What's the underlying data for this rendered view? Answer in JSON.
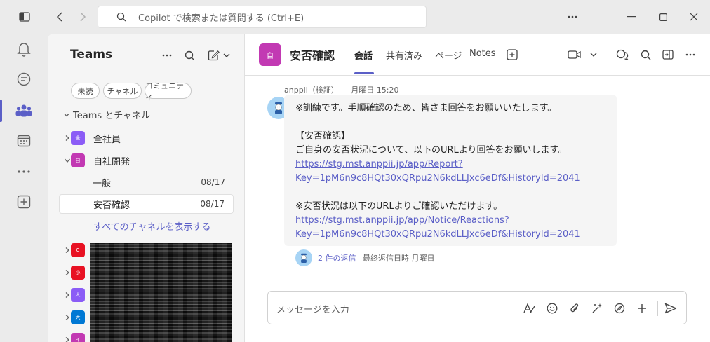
{
  "titlebar": {
    "search_placeholder": "Copilot で検索または質問する (Ctrl+E)"
  },
  "panel": {
    "title": "Teams",
    "filters": [
      "未読",
      "チャネル",
      "コミュニティ"
    ],
    "section_header": "Teams とチャネル",
    "teams": [
      {
        "name": "全社員",
        "avatar": "全",
        "color": "#8b5cf6",
        "expanded": false
      },
      {
        "name": "自社開発",
        "avatar": "自",
        "color": "#c239b3",
        "expanded": true
      }
    ],
    "channels": [
      {
        "name": "一般",
        "date": "08/17",
        "active": false
      },
      {
        "name": "安否確認",
        "date": "08/17",
        "active": true
      }
    ],
    "show_all": "すべてのチャネルを表示する",
    "other_teams": [
      {
        "avatar": "C",
        "color": "#e81123"
      },
      {
        "avatar": "小",
        "color": "#e81123"
      },
      {
        "avatar": "人",
        "color": "#8b5cf6"
      },
      {
        "avatar": "大",
        "color": "#0078d4"
      },
      {
        "avatar": "イ",
        "color": "#c239b3"
      }
    ]
  },
  "channel": {
    "avatar": "自",
    "title": "安否確認",
    "tabs": [
      "会話",
      "共有済み",
      "ページ",
      "Notes"
    ]
  },
  "message": {
    "sender": "anppii（検証）",
    "time": "月曜日 15:20",
    "lines": [
      "※訓練です。手順確認のため、皆さま回答をお願いいたします。",
      "",
      "【安否確認】",
      "ご自身の安否状況について、以下のURLより回答をお願いします。"
    ],
    "link1_a": "https://stg.mst.anppii.jp/app/Report?",
    "link1_b": "Key=1pM6n9c8HQt30xQRpu2N6kdLLJxc6eDf&HistoryId=2041",
    "line_after": "※安否状況は以下のURLよりご確認いただけます。",
    "link2_a": "https://stg.mst.anppii.jp/app/Notice/Reactions?",
    "link2_b": "Key=1pM6n9c8HQt30xQRpu2N6kdLLJxc6eDf&HistoryId=2041"
  },
  "replies": {
    "count": "2 件の返信",
    "last": "最終返信日時 月曜日"
  },
  "compose": {
    "placeholder": "メッセージを入力"
  }
}
